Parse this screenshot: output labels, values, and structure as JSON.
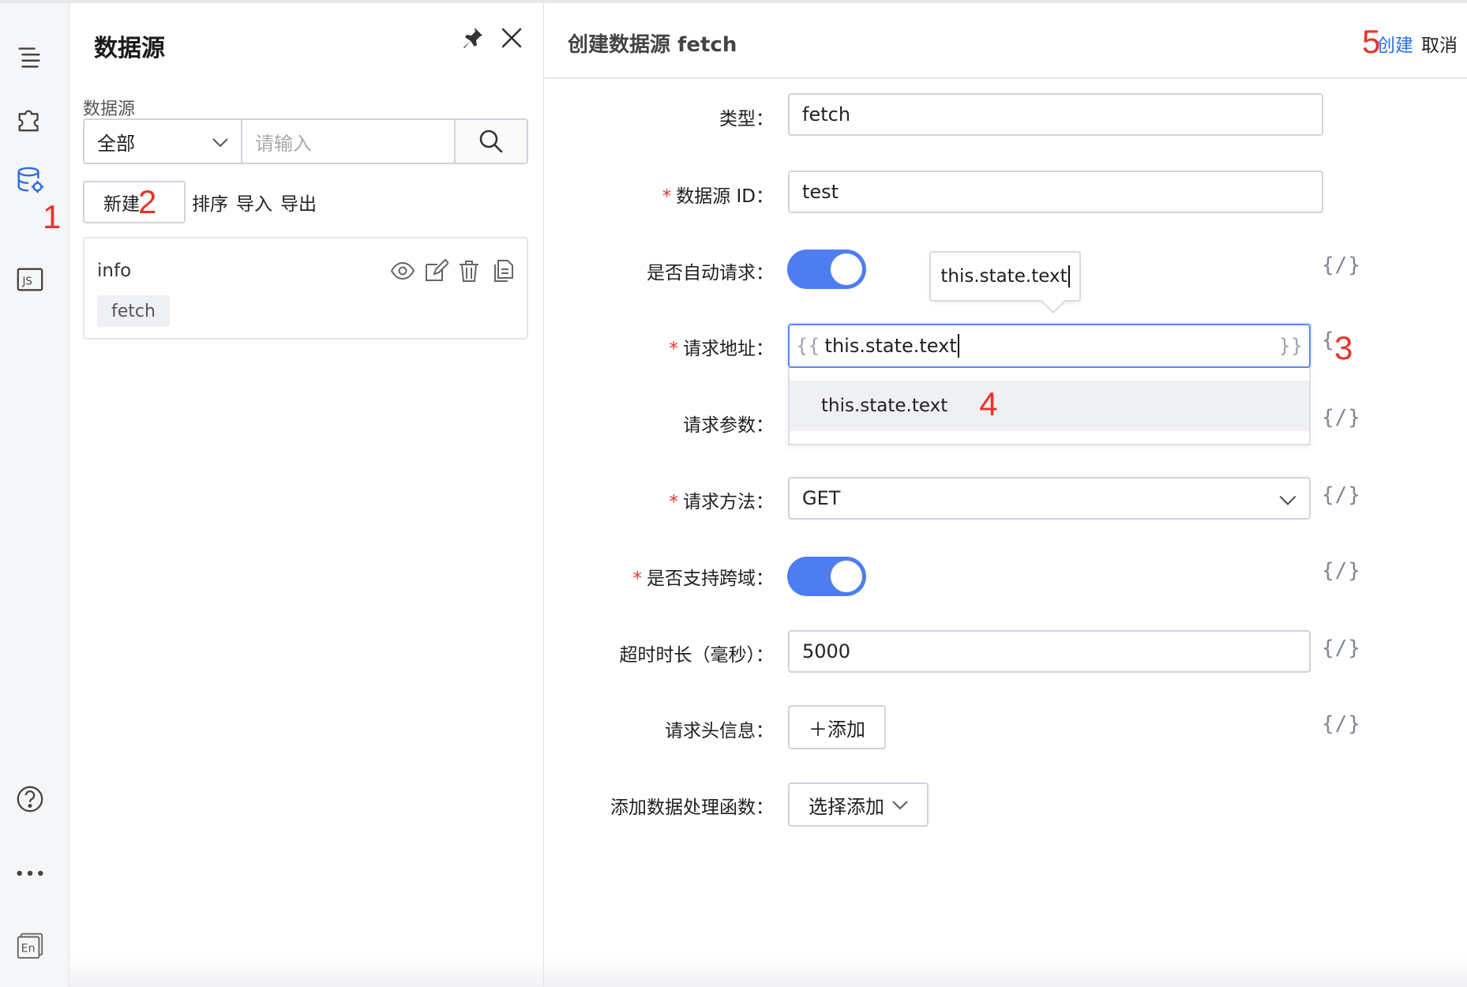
{
  "panel": {
    "title": "数据源",
    "filter_label": "数据源",
    "filter_select": "全部",
    "filter_placeholder": "请输入",
    "new_button": "新建",
    "links": [
      "排序",
      "导入",
      "导出"
    ],
    "card": {
      "name": "info",
      "tag": "fetch"
    }
  },
  "main": {
    "title": "创建数据源 fetch",
    "create": "创建",
    "cancel": "取消",
    "labels": {
      "type": "类型",
      "id": "数据源 ID",
      "auto": "是否自动请求",
      "url": "请求地址",
      "params": "请求参数",
      "method": "请求方法",
      "cors": "是否支持跨域",
      "timeout": "超时时长（毫秒）",
      "headers": "请求头信息",
      "handler": "添加数据处理函数"
    },
    "values": {
      "type": "fetch",
      "id": "test",
      "url_expr": "this.state.text",
      "method": "GET",
      "timeout": "5000",
      "auto_on": true,
      "cors_on": true
    },
    "tooltip": "this.state.text",
    "suggestion": "this.state.text",
    "add_button": "＋添加",
    "handler_button": "选择添加",
    "expr_icon": "{/}",
    "brace_open": "{{",
    "brace_close": "}}",
    "colon": "："
  },
  "annotations": [
    "1",
    "2",
    "3",
    "4",
    "5"
  ],
  "colors": {
    "accent": "#4e7df2",
    "required": "#e8332a",
    "annotation": "#e8332a"
  }
}
